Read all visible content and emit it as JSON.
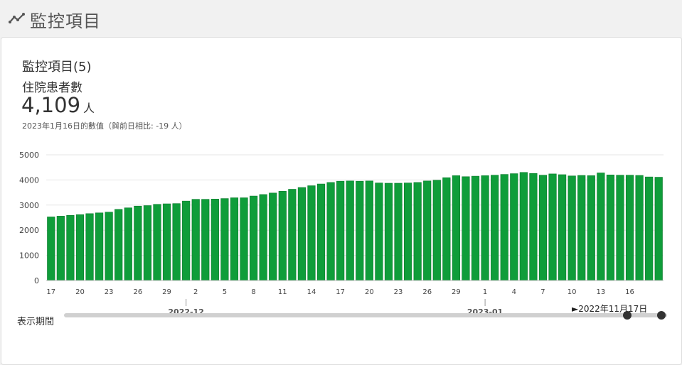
{
  "header": {
    "title": "監控項目",
    "icon": "trend-line-icon"
  },
  "card": {
    "title": "監控項目(5)",
    "metric_name": "住院患者數",
    "value": "4,109",
    "unit": "人",
    "note": "2023年1月16日的數值（與前日相比: -19 人）"
  },
  "range": {
    "label": "表示期間",
    "start_date": "►2022年11月17日"
  },
  "colors": {
    "bar": "#0f9d3a",
    "bar_edge": "#0b7a2c",
    "grid": "#e6e6e6"
  },
  "chart_data": {
    "type": "bar",
    "title": "",
    "xlabel": "",
    "ylabel": "",
    "ylim": [
      0,
      5000
    ],
    "yticks": [
      0,
      1000,
      2000,
      3000,
      4000,
      5000
    ],
    "grid": true,
    "categories": [
      "2022-11-17",
      "2022-11-18",
      "2022-11-19",
      "2022-11-20",
      "2022-11-21",
      "2022-11-22",
      "2022-11-23",
      "2022-11-24",
      "2022-11-25",
      "2022-11-26",
      "2022-11-27",
      "2022-11-28",
      "2022-11-29",
      "2022-11-30",
      "2022-12-01",
      "2022-12-02",
      "2022-12-03",
      "2022-12-04",
      "2022-12-05",
      "2022-12-06",
      "2022-12-07",
      "2022-12-08",
      "2022-12-09",
      "2022-12-10",
      "2022-12-11",
      "2022-12-12",
      "2022-12-13",
      "2022-12-14",
      "2022-12-15",
      "2022-12-16",
      "2022-12-17",
      "2022-12-18",
      "2022-12-19",
      "2022-12-20",
      "2022-12-21",
      "2022-12-22",
      "2022-12-23",
      "2022-12-24",
      "2022-12-25",
      "2022-12-26",
      "2022-12-27",
      "2022-12-28",
      "2022-12-29",
      "2022-12-30",
      "2022-12-31",
      "2023-01-01",
      "2023-01-02",
      "2023-01-03",
      "2023-01-04",
      "2023-01-05",
      "2023-01-06",
      "2023-01-07",
      "2023-01-08",
      "2023-01-09",
      "2023-01-10",
      "2023-01-11",
      "2023-01-12",
      "2023-01-13",
      "2023-01-14",
      "2023-01-15",
      "2023-01-16"
    ],
    "values": [
      2530,
      2560,
      2590,
      2620,
      2660,
      2690,
      2720,
      2830,
      2890,
      2960,
      2980,
      3030,
      3050,
      3060,
      3160,
      3230,
      3230,
      3240,
      3260,
      3290,
      3290,
      3360,
      3420,
      3480,
      3550,
      3630,
      3700,
      3770,
      3840,
      3900,
      3950,
      3960,
      3950,
      3960,
      3880,
      3870,
      3870,
      3880,
      3900,
      3960,
      3990,
      4090,
      4170,
      4130,
      4150,
      4170,
      4190,
      4220,
      4250,
      4300,
      4260,
      4190,
      4240,
      4210,
      4160,
      4180,
      4170,
      4280,
      4200,
      4190,
      4190,
      4180,
      4120,
      4109
    ],
    "x_tick_labels": [
      "17",
      "20",
      "23",
      "26",
      "29",
      "2",
      "5",
      "8",
      "11",
      "14",
      "17",
      "20",
      "23",
      "26",
      "29",
      "1",
      "4",
      "7",
      "10",
      "13",
      "16"
    ],
    "x_group_labels": [
      "2022-12",
      "2023-01"
    ]
  }
}
